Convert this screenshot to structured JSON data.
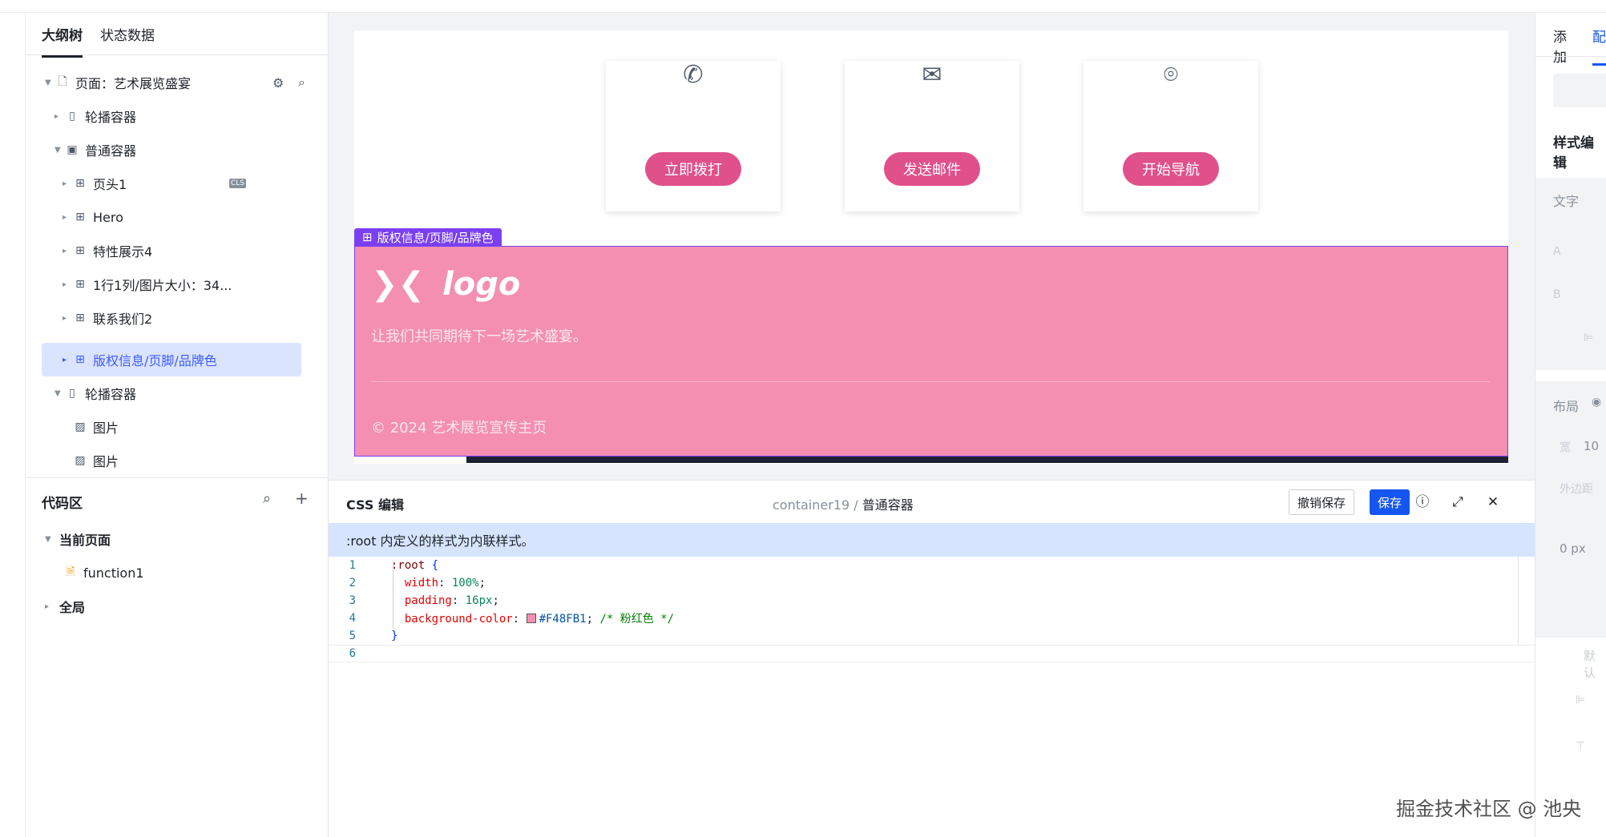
{
  "left_panel": {
    "tabs": [
      "大纲树",
      "状态数据"
    ],
    "tree": [
      {
        "label": "页面：艺术展览盛宴",
        "icon": "page-icon"
      },
      {
        "label": "轮播容器",
        "icon": "carousel-icon"
      },
      {
        "label": "普通容器",
        "icon": "container-icon"
      },
      {
        "label": "页头1",
        "icon": "block-icon",
        "badge": "CLS"
      },
      {
        "label": "Hero",
        "icon": "block-icon"
      },
      {
        "label": "特性展示4",
        "icon": "block-icon"
      },
      {
        "label": "1行1列/图片大小：34...",
        "icon": "block-icon"
      },
      {
        "label": "联系我们2",
        "icon": "block-icon"
      },
      {
        "label": "版权信息/页脚/品牌色",
        "icon": "block-icon",
        "selected": true
      },
      {
        "label": "轮播容器",
        "icon": "carousel-icon"
      },
      {
        "label": "图片",
        "icon": "image-icon"
      },
      {
        "label": "图片",
        "icon": "image-icon"
      }
    ],
    "code_area": {
      "title": "代码区",
      "current_page": "当前页面",
      "function": "function1",
      "global": "全局"
    }
  },
  "canvas": {
    "cards": [
      {
        "icon": "phone-icon",
        "button": "立即拨打"
      },
      {
        "icon": "mail-icon",
        "button": "发送邮件"
      },
      {
        "icon": "location-icon",
        "button": "开始导航"
      }
    ],
    "footer_tag": "版权信息/页脚/品牌色",
    "footer": {
      "logo": "logo",
      "tagline": "让我们共同期待下一场艺术盛宴。",
      "copyright": "© 2024 艺术展览宣传主页",
      "background": "#F48FB1"
    }
  },
  "editor": {
    "title": "CSS 编辑",
    "breadcrumb_id": "container19",
    "breadcrumb_sep": "/",
    "breadcrumb_name": "普通容器",
    "revert_label": "撤销保存",
    "save_label": "保存",
    "notice": ":root 内定义的样式为内联样式。",
    "code": {
      "l1_sel": ":root",
      "l1_brace": " {",
      "l2_prop": "width",
      "l2_val": "100%",
      "l3_prop": "padding",
      "l3_val": "16px",
      "l4_prop": "background-color",
      "l4_val": "#F48FB1",
      "l4_comment": "/* 粉红色 */",
      "l5": "}"
    }
  },
  "right_panel": {
    "tabs": [
      "添加",
      "配"
    ],
    "style_edit": "样式编辑",
    "text_section": "文字",
    "layout_section": "布局",
    "width_label": "宽",
    "width_val": "10",
    "margin_label": "外边距",
    "px_val": "0 px",
    "default_label": "默认"
  },
  "watermark": "掘金技术社区 @ 池央"
}
